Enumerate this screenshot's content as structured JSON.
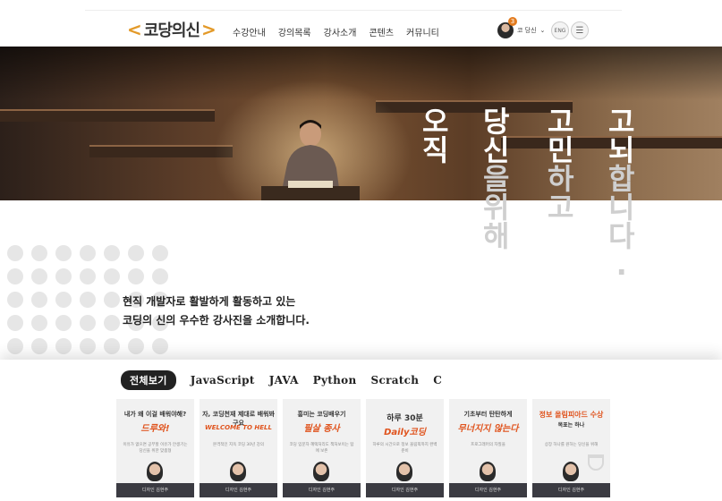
{
  "header": {
    "logo_text": "코당의신",
    "nav": [
      "수강안내",
      "강의목록",
      "강사소개",
      "콘텐츠",
      "커뮤니티"
    ],
    "user_name": "코 당신",
    "notification_count": "3",
    "lang_label": "ENG"
  },
  "hero": {
    "col1": [
      "오",
      "직"
    ],
    "col2": [
      "당",
      "신",
      "을",
      "위",
      "해"
    ],
    "col3": [
      "고",
      "민",
      "하",
      "고"
    ],
    "col4": [
      "고",
      "뇌",
      "합",
      "니",
      "다",
      "."
    ]
  },
  "intro": {
    "line1": "현직 개발자로 활발하게 활동하고 있는",
    "line2": "코딩의 신의 우수한 강사진을 소개합니다."
  },
  "tabs": [
    "전체보기",
    "JavaScript",
    "JAVA",
    "Python",
    "Scratch",
    "C"
  ],
  "cards": [
    {
      "top": "내가 왜 이걸 배워야해?",
      "big": "드루와!",
      "sub": "이유가 없으면 공부할 이유가 안생기는 당신을 위한 맞춤형",
      "footer": "디자인 김현주"
    },
    {
      "top": "자, 코딩천재 제대로 배워봐구요",
      "big": "WELCOME TO HELL",
      "sub": "본격적인 지옥 코딩 30년 강의",
      "footer": "디자인 김현주"
    },
    {
      "top": "흥미는 코딩배우기",
      "big": "필살 종사",
      "sub": "코딩 입문자 혜택처리도 책처보이는 탑에 보존",
      "footer": "디자인 김현주"
    },
    {
      "top": "하루 30분",
      "big": "Daily코딩",
      "sub": "하루의 시간으로 정보 올림픽까지 완벽 준비",
      "footer": "디자인 김현주"
    },
    {
      "top": "기초부터 탄탄하게",
      "big": "무너지지 않는다",
      "sub": "프로그래머의 자질을",
      "footer": "디자인 김현주"
    },
    {
      "top": "정보 올림피아드 수상",
      "big": "목표는 하나",
      "sub": "상장 하나를 원하는 당신을 위해",
      "footer": "디자인 김현주"
    }
  ]
}
